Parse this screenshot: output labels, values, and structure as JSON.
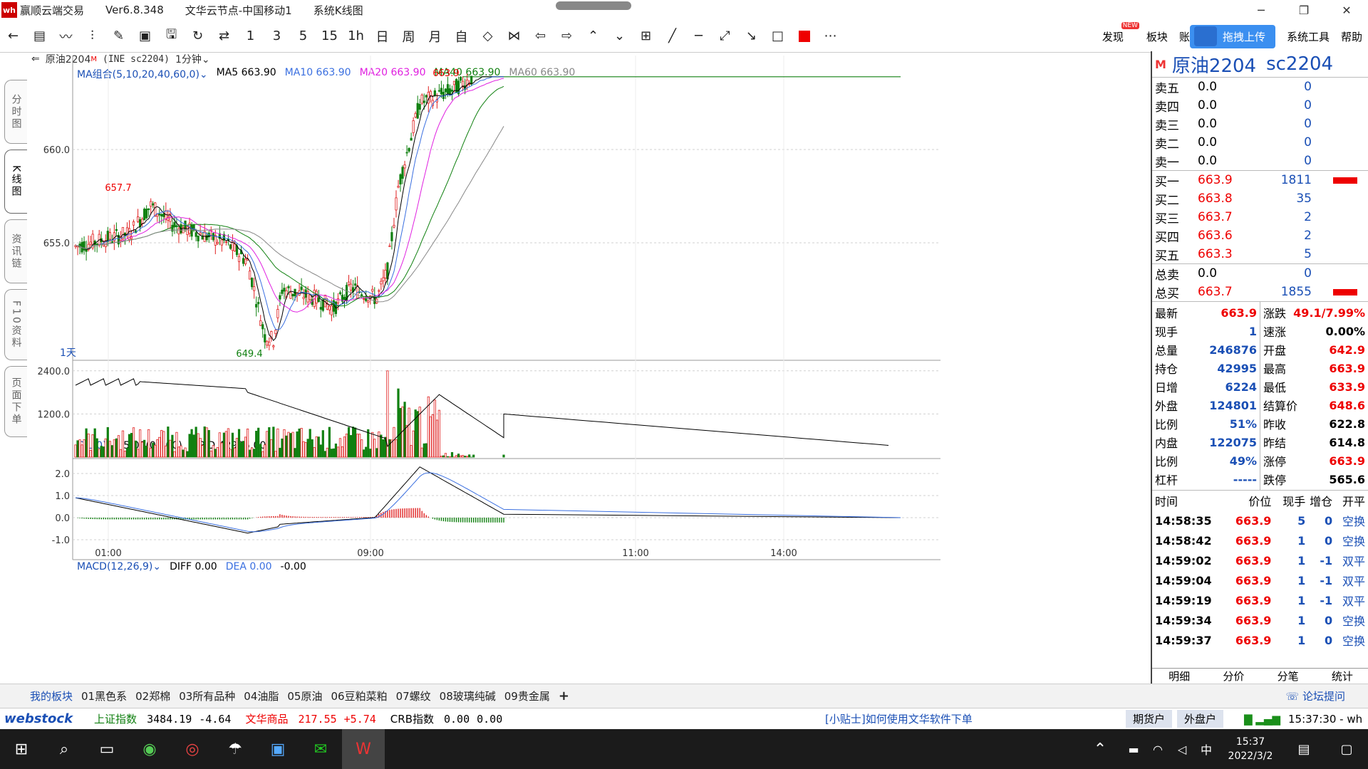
{
  "window": {
    "title": "赢顺云端交易",
    "version": "Ver6.8.348",
    "node": "文华云节点-中国移动1",
    "view": "系统K线图",
    "logo_text": "wh"
  },
  "toolbar": {
    "periods": [
      "1",
      "3",
      "5",
      "15",
      "1h",
      "日",
      "周",
      "月",
      "自"
    ],
    "right_items": {
      "discover": "发现",
      "new_badge": "NEW",
      "sector": "板块",
      "account": "账",
      "upload": "拖拽上传",
      "tools": "系统工具",
      "help": "帮助"
    }
  },
  "left_tabs": [
    "分时图",
    "K线图",
    "资讯链",
    "F10资料",
    "页面下单"
  ],
  "chart": {
    "info": {
      "symbol": "原油2204",
      "code": "(INE sc2204)",
      "superscript": "M",
      "period": "1分钟"
    },
    "ma_legend": [
      {
        "label": "MA组合(5,10,20,40,60,0)",
        "color": "#1a4fb5"
      },
      {
        "label": "MA5 663.90",
        "color": "#000000"
      },
      {
        "label": "MA10 663.90",
        "color": "#3a6fe0"
      },
      {
        "label": "MA20 663.90",
        "color": "#e020e0"
      },
      {
        "label": "MA40 663.90",
        "color": "#108010"
      },
      {
        "label": "MA60 663.90",
        "color": "#888888"
      }
    ],
    "high_label": "663.9",
    "local_high_label": "657.7",
    "low_label": "649.4",
    "corner_label": "1天",
    "price_ticks": [
      "660.0",
      "655.0"
    ],
    "vol_header": {
      "name": "CJL(0)",
      "param": "5.00(0:100)",
      "opid": "OPID 42995.00"
    },
    "vol_ticks": [
      "2400.0",
      "1200.0"
    ],
    "macd_header": {
      "name": "MACD(12,26,9)",
      "diff": "DIFF 0.00",
      "dea": "DEA 0.00",
      "val": "-0.00"
    },
    "macd_ticks": [
      "2.0",
      "1.0",
      "0.0",
      "-1.0"
    ],
    "time_ticks": [
      "01:00",
      "09:00",
      "11:00",
      "14:00"
    ],
    "colors": {
      "up": "#e02020",
      "down": "#108010",
      "grid": "#d0d0d0"
    }
  },
  "panel": {
    "marker": "M",
    "name": "原油2204",
    "code": "sc2204",
    "asks": [
      {
        "label": "卖五",
        "price": "0.0",
        "vol": "0"
      },
      {
        "label": "卖四",
        "price": "0.0",
        "vol": "0"
      },
      {
        "label": "卖三",
        "price": "0.0",
        "vol": "0"
      },
      {
        "label": "卖二",
        "price": "0.0",
        "vol": "0"
      },
      {
        "label": "卖一",
        "price": "0.0",
        "vol": "0"
      }
    ],
    "bids": [
      {
        "label": "买一",
        "price": "663.9",
        "vol": "1811",
        "bar": 1
      },
      {
        "label": "买二",
        "price": "663.8",
        "vol": "35",
        "bar": 0
      },
      {
        "label": "买三",
        "price": "663.7",
        "vol": "2",
        "bar": 0
      },
      {
        "label": "买四",
        "price": "663.6",
        "vol": "2",
        "bar": 0
      },
      {
        "label": "买五",
        "price": "663.3",
        "vol": "5",
        "bar": 0
      }
    ],
    "totals": [
      {
        "label": "总卖",
        "price": "0.0",
        "vol": "0",
        "bar": 0
      },
      {
        "label": "总买",
        "price": "663.7",
        "vol": "1855",
        "bar": 1
      }
    ],
    "stats_left": [
      {
        "label": "最新",
        "value": "663.9",
        "red": true
      },
      {
        "label": "现手",
        "value": "1",
        "red": false
      },
      {
        "label": "总量",
        "value": "246876",
        "red": false
      },
      {
        "label": "持仓",
        "value": "42995",
        "red": false
      },
      {
        "label": "日增",
        "value": "6224",
        "red": false
      },
      {
        "label": "外盘",
        "value": "124801",
        "red": false
      },
      {
        "label": "比例",
        "value": "51%",
        "red": false
      },
      {
        "label": "内盘",
        "value": "122075",
        "red": false
      },
      {
        "label": "比例",
        "value": "49%",
        "red": false
      },
      {
        "label": "杠杆",
        "value": "-----",
        "red": false
      }
    ],
    "stats_right": [
      {
        "label": "涨跌",
        "value": "49.1/7.99%",
        "red": true
      },
      {
        "label": "速涨",
        "value": "0.00%",
        "red": false
      },
      {
        "label": "开盘",
        "value": "642.9",
        "red": true
      },
      {
        "label": "最高",
        "value": "663.9",
        "red": true
      },
      {
        "label": "最低",
        "value": "633.9",
        "red": true
      },
      {
        "label": "结算价",
        "value": "648.6",
        "red": true
      },
      {
        "label": "昨收",
        "value": "622.8",
        "red": false
      },
      {
        "label": "昨结",
        "value": "614.8",
        "red": false
      },
      {
        "label": "涨停",
        "value": "663.9",
        "red": true
      },
      {
        "label": "跌停",
        "value": "565.6",
        "red": false
      }
    ],
    "trade_header": {
      "time": "时间",
      "price": "价位",
      "qty": "现手",
      "oi": "增仓",
      "type": "开平"
    },
    "trades": [
      {
        "time": "14:58:35",
        "price": "663.9",
        "qty": "5",
        "oi": "0",
        "type": "空换"
      },
      {
        "time": "14:58:42",
        "price": "663.9",
        "qty": "1",
        "oi": "0",
        "type": "空换"
      },
      {
        "time": "14:59:02",
        "price": "663.9",
        "qty": "1",
        "oi": "-1",
        "type": "双平"
      },
      {
        "time": "14:59:04",
        "price": "663.9",
        "qty": "1",
        "oi": "-1",
        "type": "双平"
      },
      {
        "time": "14:59:19",
        "price": "663.9",
        "qty": "1",
        "oi": "-1",
        "type": "双平"
      },
      {
        "time": "14:59:34",
        "price": "663.9",
        "qty": "1",
        "oi": "0",
        "type": "空换"
      },
      {
        "time": "14:59:37",
        "price": "663.9",
        "qty": "1",
        "oi": "0",
        "type": "空换"
      }
    ],
    "tabs": [
      "明细",
      "分价",
      "分笔",
      "统计"
    ]
  },
  "boards": [
    "我的板块",
    "01黑色系",
    "02郑棉",
    "03所有品种",
    "04油脂",
    "05原油",
    "06豆粕菜粕",
    "07螺纹",
    "08玻璃纯碱",
    "09贵金属",
    "+",
    "论坛提问"
  ],
  "status": {
    "brand": "webstock",
    "sh_label": "上证指数",
    "sh_value": "3484.19",
    "sh_change": "-4.64",
    "wh_label": "文华商品",
    "wh_value": "217.55",
    "wh_change": "+5.74",
    "crb_label": "CRB指数",
    "crb_value": "0.00",
    "crb_change": "0.00",
    "tip": "[小贴士]如何使用文华软件下单",
    "futures_account": "期货户",
    "forex_account": "外盘户",
    "clock": "15:37:30 - wh"
  },
  "taskbar": {
    "time": "15:37",
    "date": "2022/3/2",
    "ime": "中"
  }
}
